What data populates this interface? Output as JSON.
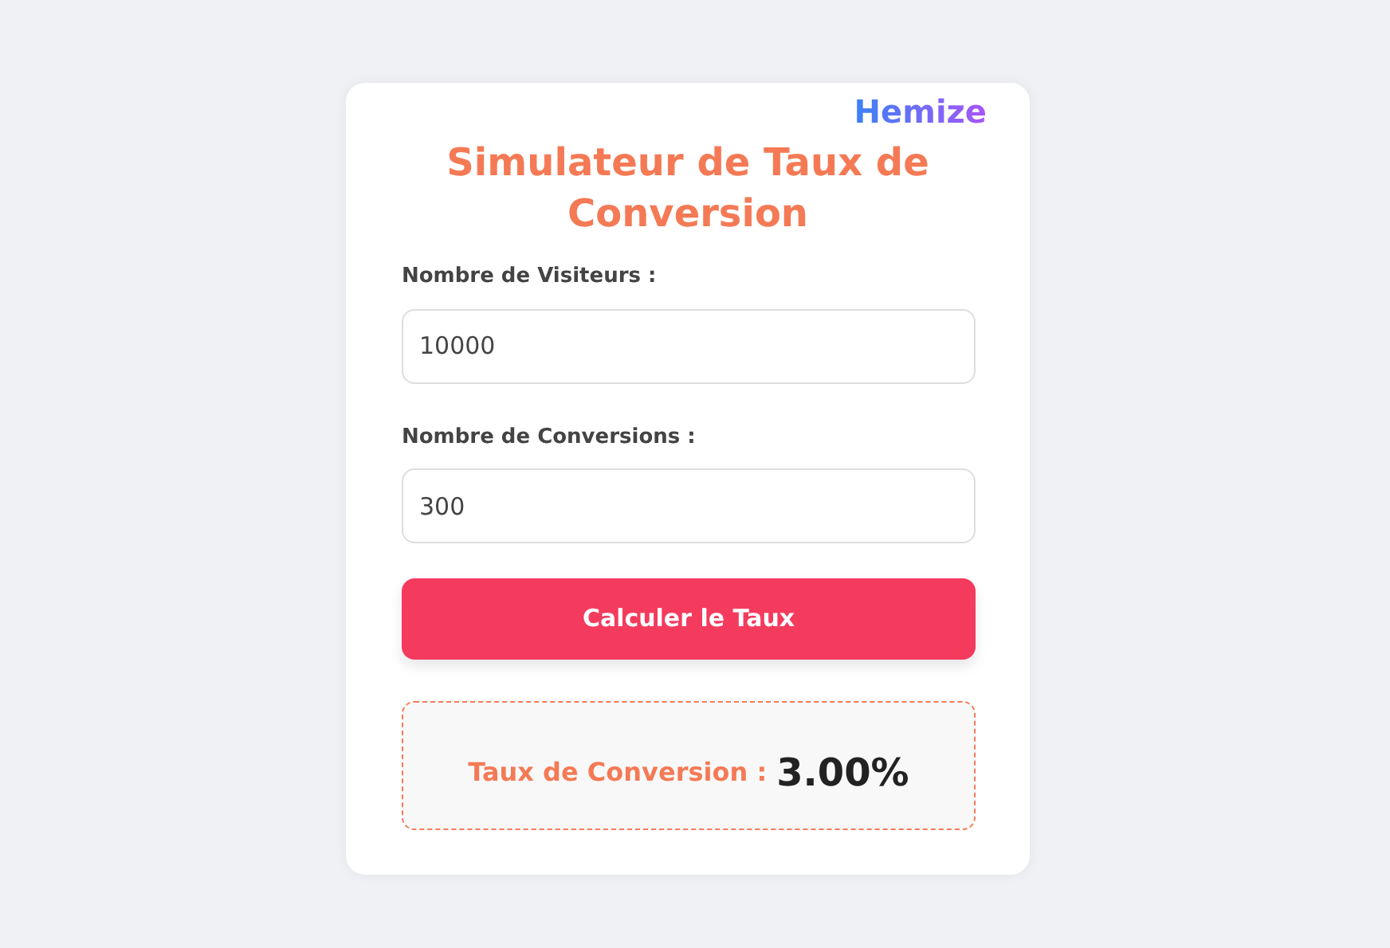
{
  "logo": "Hemize",
  "title": "Simulateur de Taux de Conversion",
  "fields": [
    {
      "label": "Nombre de Visiteurs :",
      "value": "10000"
    },
    {
      "label": "Nombre de Conversions :",
      "value": "300"
    }
  ],
  "button": "Calculer le Taux",
  "result": {
    "label": "Taux de Conversion :",
    "value": "3.00%"
  }
}
